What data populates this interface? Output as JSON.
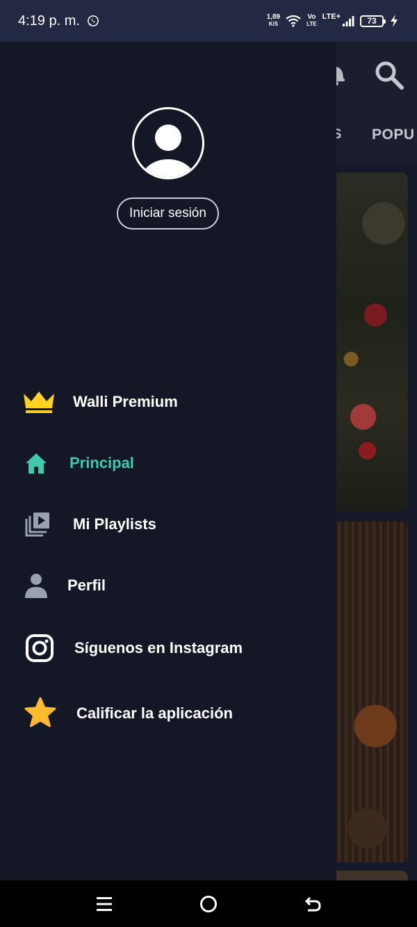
{
  "status_bar": {
    "time": "4:19 p. m.",
    "net_speed_value": "1,89",
    "net_speed_unit": "K/S",
    "volte_top": "Vo",
    "volte_bottom": "LTE",
    "lte": "LTE+",
    "battery": "73"
  },
  "background_app": {
    "tab_partial": "S",
    "tab_popular_partial": "POPU"
  },
  "drawer": {
    "login_label": "Iniciar sesión",
    "menu": [
      {
        "label": "Walli Premium",
        "icon": "crown-icon",
        "color": "#ffd21f"
      },
      {
        "label": "Principal",
        "icon": "home-icon",
        "color": "#3fc9ae",
        "active": true
      },
      {
        "label": "Mi Playlists",
        "icon": "playlist-icon",
        "color": "#9aa0ad"
      },
      {
        "label": "Perfil",
        "icon": "person-icon",
        "color": "#9aa0ad"
      },
      {
        "label": "Síguenos en Instagram",
        "icon": "instagram-icon",
        "color": "#ffffff"
      },
      {
        "label": "Calificar la aplicación",
        "icon": "star-icon",
        "color": "#ffbb2d"
      }
    ]
  },
  "colors": {
    "status_bar": "#232843",
    "drawer_bg": "#131726",
    "active_accent": "#3fc9ae",
    "text": "#ffffff"
  }
}
